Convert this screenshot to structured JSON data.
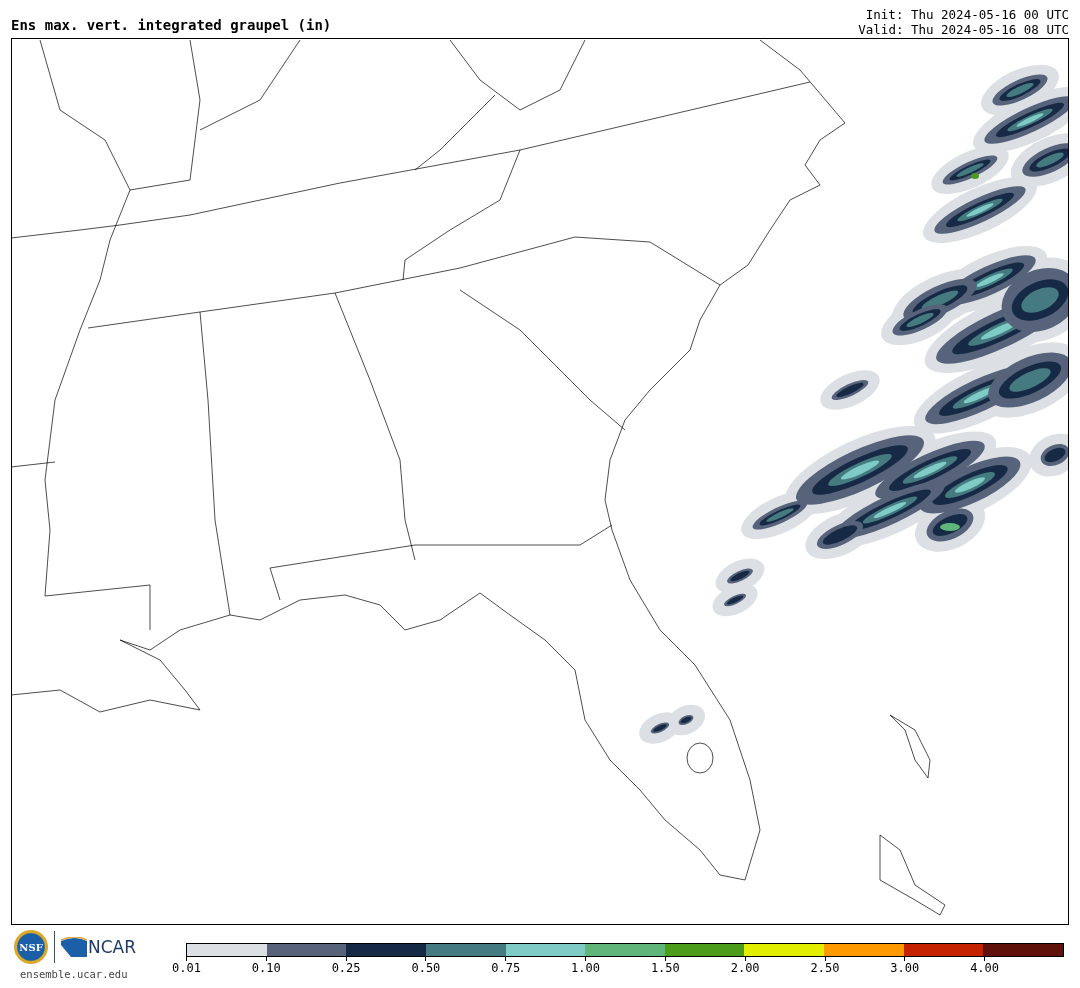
{
  "title": "Ens max. vert. integrated graupel (in)",
  "init": "Init: Thu 2024-05-16 00 UTC",
  "valid": "Valid: Thu 2024-05-16 08 UTC",
  "footer": {
    "nsf_logo": "NSF",
    "ncar_logo": "NCAR",
    "url": "ensemble.ucar.edu"
  },
  "colorbar": {
    "bins": [
      {
        "label": "0.01",
        "color": "#dce0e4"
      },
      {
        "label": "0.10",
        "color": "#56637a"
      },
      {
        "label": "0.25",
        "color": "#172a45"
      },
      {
        "label": "0.50",
        "color": "#457a80"
      },
      {
        "label": "0.75",
        "color": "#7fcbc6"
      },
      {
        "label": "1.00",
        "color": "#60b57a"
      },
      {
        "label": "1.50",
        "color": "#4c9c1c"
      },
      {
        "label": "2.00",
        "color": "#e2ee00"
      },
      {
        "label": "2.50",
        "color": "#ff9900"
      },
      {
        "label": "3.00",
        "color": "#c42200"
      },
      {
        "label": "4.00",
        "color": "#5f1209"
      }
    ]
  }
}
